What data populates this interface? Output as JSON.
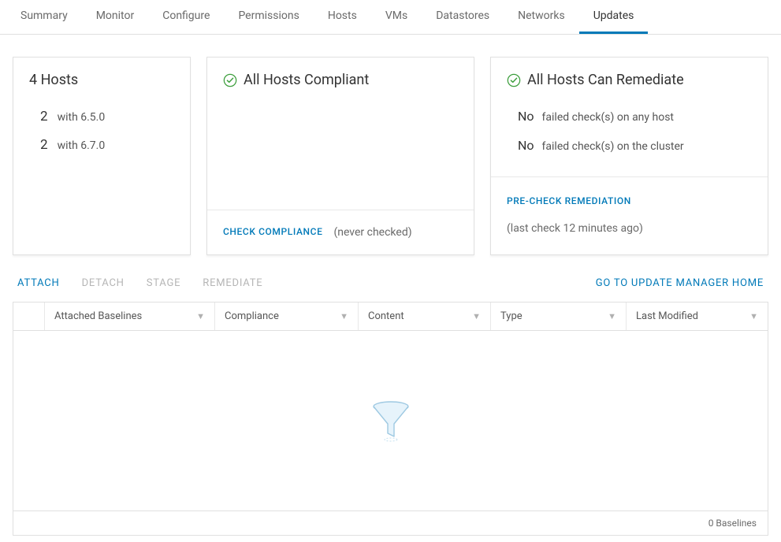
{
  "tabs": {
    "summary": "Summary",
    "monitor": "Monitor",
    "configure": "Configure",
    "permissions": "Permissions",
    "hosts": "Hosts",
    "vms": "VMs",
    "datastores": "Datastores",
    "networks": "Networks",
    "updates": "Updates"
  },
  "hosts_card": {
    "title": "4 Hosts",
    "rows": [
      {
        "count": "2",
        "desc": "with 6.5.0"
      },
      {
        "count": "2",
        "desc": "with 6.7.0"
      }
    ]
  },
  "compliance_card": {
    "title": "All Hosts Compliant",
    "check_label": "CHECK COMPLIANCE",
    "meta": "(never checked)"
  },
  "remediate_card": {
    "title": "All Hosts Can Remediate",
    "rows": [
      {
        "no": "No",
        "desc": "failed check(s) on any host"
      },
      {
        "no": "No",
        "desc": "failed check(s) on the cluster"
      }
    ],
    "precheck_label": "PRE-CHECK REMEDIATION",
    "meta": "(last check 12 minutes ago)"
  },
  "actions": {
    "attach": "ATTACH",
    "detach": "DETACH",
    "stage": "STAGE",
    "remediate": "REMEDIATE",
    "goto": "GO TO UPDATE MANAGER HOME"
  },
  "table": {
    "headers": {
      "baselines": "Attached Baselines",
      "compliance": "Compliance",
      "content": "Content",
      "type": "Type",
      "modified": "Last Modified"
    },
    "footer": "0 Baselines"
  }
}
